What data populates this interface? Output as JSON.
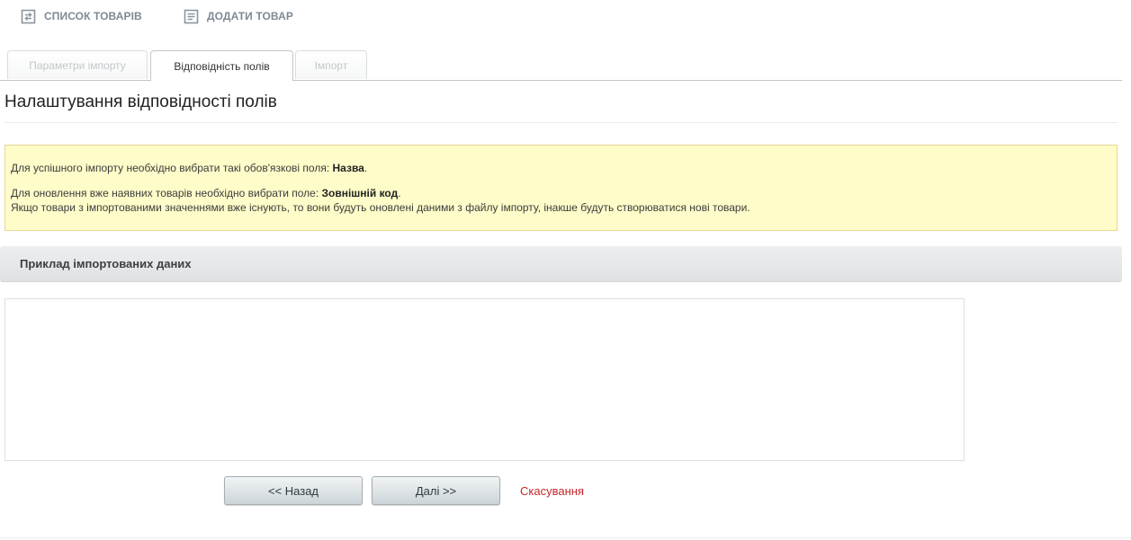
{
  "toolbar": {
    "items": [
      {
        "label": "СПИСОК ТОВАРІВ",
        "icon": "list-refresh-icon"
      },
      {
        "label": "ДОДАТИ ТОВАР",
        "icon": "add-document-icon"
      }
    ]
  },
  "tabs": [
    {
      "label": "Параметри імпорту",
      "active": false
    },
    {
      "label": "Відповідність полів",
      "active": true
    },
    {
      "label": "Імпорт",
      "active": false
    }
  ],
  "page": {
    "title": "Налаштування відповідності полів"
  },
  "notice": {
    "line1_text": "Для успішного імпорту необхідно вибрати такі обов'язкові поля: ",
    "line1_bold": "Назва",
    "line1_end": ".",
    "line2_text": "Для оновлення вже наявних товарів необхідно вибрати поле: ",
    "line2_bold": "Зовнішній код",
    "line2_end": ".",
    "line3_text": "Якщо товари з імпортованими значеннями вже існують, то вони будуть оновлені даними з файлу імпорту, інакше будуть створюватися нові товари."
  },
  "section": {
    "title": "Приклад імпортованих даних"
  },
  "buttons": {
    "back": "<< Назад",
    "next": "Далі >>",
    "cancel": "Скасування"
  },
  "colors": {
    "notice_bg": "#fefcc9",
    "notice_border": "#e9d68e",
    "cancel_link": "#c3282a",
    "toolbar_text": "#7d8a94"
  }
}
